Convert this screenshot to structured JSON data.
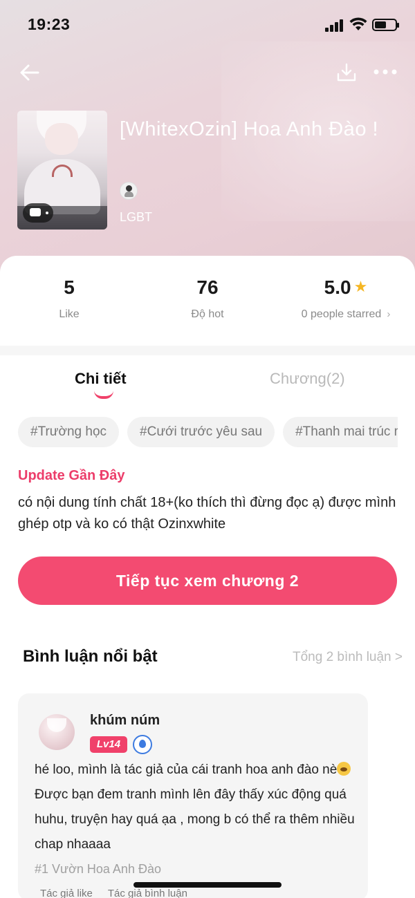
{
  "status_bar": {
    "time": "19:23"
  },
  "book": {
    "title": "[WhitexOzin] Hoa Anh Đào !",
    "genre": "LGBT"
  },
  "stats": {
    "like": {
      "value": "5",
      "label": "Like"
    },
    "hot": {
      "value": "76",
      "label": "Độ hot"
    },
    "rating": {
      "value": "5.0",
      "label": "0 people starred"
    }
  },
  "tabs": {
    "detail": "Chi tiết",
    "chapter": "Chương(2)"
  },
  "tags": [
    "#Trường học",
    "#Cưới trước yêu sau",
    "#Thanh mai trúc mã"
  ],
  "update": {
    "label": "Update Gần Đây",
    "description": "có nội dung tính chất 18+(ko thích thì đừng đọc ạ) được mình ghép otp và ko có thật Ozinxwhite"
  },
  "cta": {
    "label": "Tiếp tục xem chương 2"
  },
  "comments_section": {
    "title": "Bình luận nổi bật",
    "total_link": "Tổng 2 bình luận >",
    "items": [
      {
        "name": "khúm núm",
        "level": "Lv14",
        "text_before_emoji": "hé loo, mình là tác giả của cái tranh hoa anh đào nè",
        "text_after_emoji": " Được bạn đem tranh mình lên đây thấy xúc động quá huhu, truyện hay quá ạa , mong b có thể ra thêm nhiều chap nhaaaa",
        "source": "#1 Vườn Hoa Anh Đào",
        "meta_author_like": "Tác giả like",
        "meta_author_comment": "Tác giả bình luận"
      }
    ]
  },
  "colors": {
    "accent": "#f34b71",
    "star": "#f5b623",
    "tab_underline": "#f0416a"
  },
  "icons": [
    "back-arrow-icon",
    "download-icon",
    "more-icon",
    "star-icon",
    "comment-bubble-icon",
    "medal-icon",
    "author-avatar-icon"
  ]
}
